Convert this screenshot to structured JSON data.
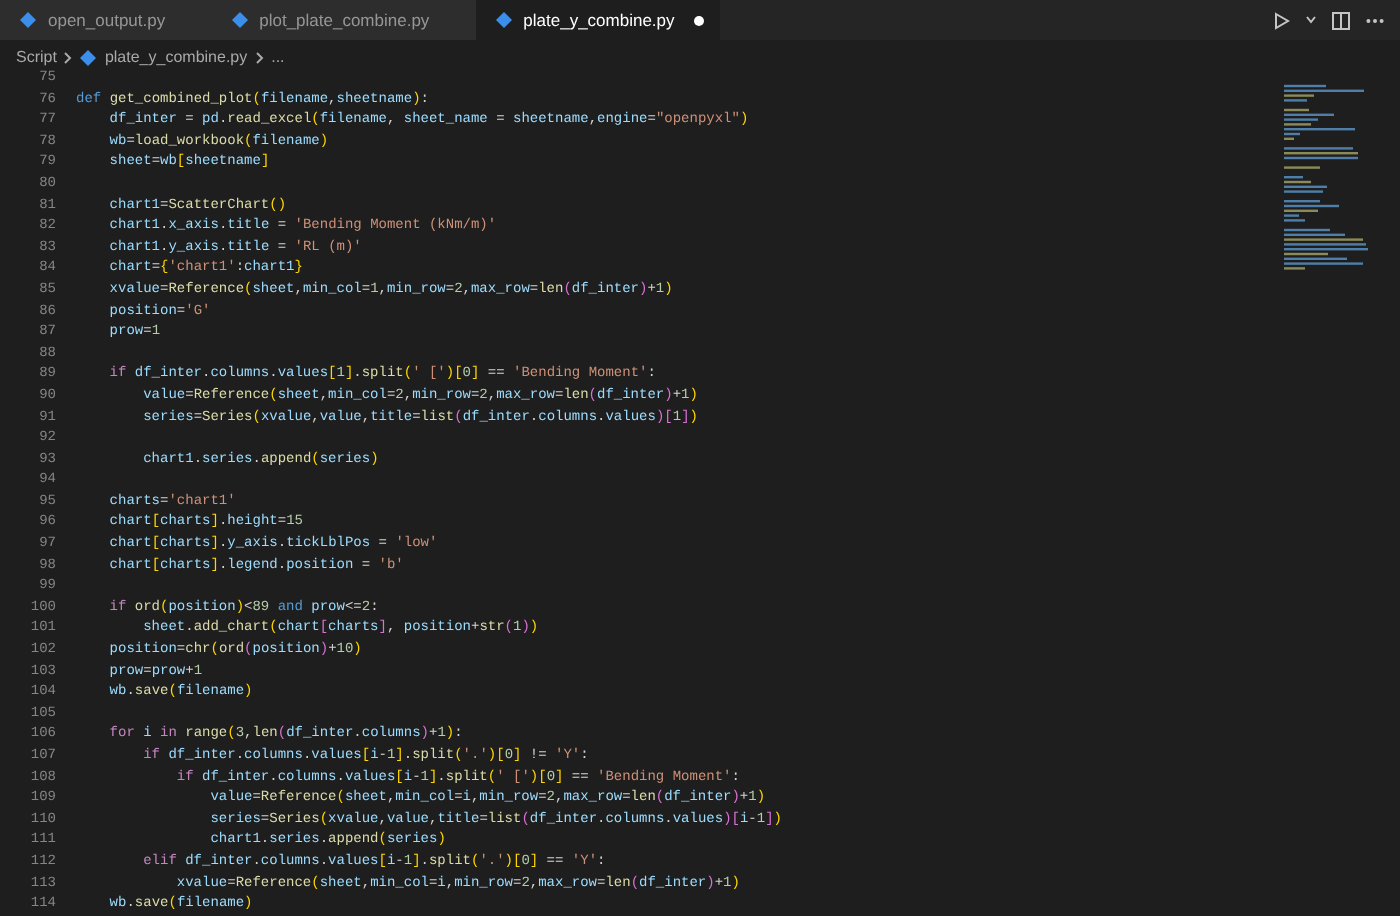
{
  "tabs": [
    {
      "label": "open_output.py",
      "selected": false,
      "modified": false
    },
    {
      "label": "plot_plate_combine.py",
      "selected": false,
      "modified": false
    },
    {
      "label": "plate_y_combine.py",
      "selected": true,
      "modified": true
    }
  ],
  "breadcrumbs": [
    {
      "label": "Script",
      "kind": "folder"
    },
    {
      "label": "plate_y_combine.py",
      "kind": "file"
    },
    {
      "label": "...",
      "kind": "more"
    }
  ],
  "code_lines": [
    {
      "number": "75"
    },
    {
      "number": "76",
      "tokens": [
        {
          "kind": "keyword",
          "text": "def "
        },
        {
          "kind": "function",
          "text": "get_combined_plot"
        },
        {
          "kind": "bracket1",
          "text": "("
        },
        {
          "kind": "name",
          "text": "filename"
        },
        {
          "kind": "plain",
          "text": ","
        },
        {
          "kind": "name",
          "text": "sheetname"
        },
        {
          "kind": "bracket1",
          "text": ")"
        },
        {
          "kind": "plain",
          "text": ":"
        }
      ]
    },
    {
      "number": "77",
      "tokens": [
        {
          "kind": "name",
          "text": "    df_inter"
        },
        {
          "kind": "plain",
          "text": " = "
        },
        {
          "kind": "name",
          "text": "pd"
        },
        {
          "kind": "plain",
          "text": "."
        },
        {
          "kind": "function",
          "text": "read_excel"
        },
        {
          "kind": "bracket1",
          "text": "("
        },
        {
          "kind": "name",
          "text": "filename"
        },
        {
          "kind": "plain",
          "text": ", "
        },
        {
          "kind": "name",
          "text": "sheet_name"
        },
        {
          "kind": "plain",
          "text": " = "
        },
        {
          "kind": "name",
          "text": "sheetname"
        },
        {
          "kind": "plain",
          "text": ","
        },
        {
          "kind": "name",
          "text": "engine"
        },
        {
          "kind": "plain",
          "text": "="
        },
        {
          "kind": "string",
          "text": "\"openpyxl\""
        },
        {
          "kind": "bracket1",
          "text": ")"
        }
      ]
    },
    {
      "number": "78",
      "tokens": [
        {
          "kind": "name",
          "text": "    wb"
        },
        {
          "kind": "plain",
          "text": "="
        },
        {
          "kind": "function",
          "text": "load_workbook"
        },
        {
          "kind": "bracket1",
          "text": "("
        },
        {
          "kind": "name",
          "text": "filename"
        },
        {
          "kind": "bracket1",
          "text": ")"
        }
      ]
    },
    {
      "number": "79",
      "tokens": [
        {
          "kind": "name",
          "text": "    sheet"
        },
        {
          "kind": "plain",
          "text": "="
        },
        {
          "kind": "name",
          "text": "wb"
        },
        {
          "kind": "bracket1",
          "text": "["
        },
        {
          "kind": "name",
          "text": "sheetname"
        },
        {
          "kind": "bracket1",
          "text": "]"
        }
      ]
    },
    {
      "number": "80"
    },
    {
      "number": "81",
      "tokens": [
        {
          "kind": "name",
          "text": "    chart1"
        },
        {
          "kind": "plain",
          "text": "="
        },
        {
          "kind": "function",
          "text": "ScatterChart"
        },
        {
          "kind": "bracket1",
          "text": "()"
        }
      ]
    },
    {
      "number": "82",
      "tokens": [
        {
          "kind": "name",
          "text": "    chart1"
        },
        {
          "kind": "plain",
          "text": "."
        },
        {
          "kind": "name",
          "text": "x_axis"
        },
        {
          "kind": "plain",
          "text": "."
        },
        {
          "kind": "name",
          "text": "title"
        },
        {
          "kind": "plain",
          "text": " = "
        },
        {
          "kind": "string",
          "text": "'Bending Moment (kNm/m)'"
        }
      ]
    },
    {
      "number": "83",
      "tokens": [
        {
          "kind": "name",
          "text": "    chart1"
        },
        {
          "kind": "plain",
          "text": "."
        },
        {
          "kind": "name",
          "text": "y_axis"
        },
        {
          "kind": "plain",
          "text": "."
        },
        {
          "kind": "name",
          "text": "title"
        },
        {
          "kind": "plain",
          "text": " = "
        },
        {
          "kind": "string",
          "text": "'RL (m)'"
        }
      ]
    },
    {
      "number": "84",
      "tokens": [
        {
          "kind": "name",
          "text": "    chart"
        },
        {
          "kind": "plain",
          "text": "="
        },
        {
          "kind": "bracket1",
          "text": "{"
        },
        {
          "kind": "string",
          "text": "'chart1'"
        },
        {
          "kind": "plain",
          "text": ":"
        },
        {
          "kind": "name",
          "text": "chart1"
        },
        {
          "kind": "bracket1",
          "text": "}"
        }
      ]
    },
    {
      "number": "85",
      "tokens": [
        {
          "kind": "name",
          "text": "    xvalue"
        },
        {
          "kind": "plain",
          "text": "="
        },
        {
          "kind": "function",
          "text": "Reference"
        },
        {
          "kind": "bracket1",
          "text": "("
        },
        {
          "kind": "name",
          "text": "sheet"
        },
        {
          "kind": "plain",
          "text": ","
        },
        {
          "kind": "name",
          "text": "min_col"
        },
        {
          "kind": "plain",
          "text": "="
        },
        {
          "kind": "number",
          "text": "1"
        },
        {
          "kind": "plain",
          "text": ","
        },
        {
          "kind": "name",
          "text": "min_row"
        },
        {
          "kind": "plain",
          "text": "="
        },
        {
          "kind": "number",
          "text": "2"
        },
        {
          "kind": "plain",
          "text": ","
        },
        {
          "kind": "name",
          "text": "max_row"
        },
        {
          "kind": "plain",
          "text": "="
        },
        {
          "kind": "function",
          "text": "len"
        },
        {
          "kind": "bracket2",
          "text": "("
        },
        {
          "kind": "name",
          "text": "df_inter"
        },
        {
          "kind": "bracket2",
          "text": ")"
        },
        {
          "kind": "plain",
          "text": "+"
        },
        {
          "kind": "number",
          "text": "1"
        },
        {
          "kind": "bracket1",
          "text": ")"
        }
      ]
    },
    {
      "number": "86",
      "tokens": [
        {
          "kind": "name",
          "text": "    position"
        },
        {
          "kind": "plain",
          "text": "="
        },
        {
          "kind": "string",
          "text": "'G'"
        }
      ]
    },
    {
      "number": "87",
      "tokens": [
        {
          "kind": "name",
          "text": "    prow"
        },
        {
          "kind": "plain",
          "text": "="
        },
        {
          "kind": "number",
          "text": "1"
        }
      ]
    },
    {
      "number": "88"
    },
    {
      "number": "89",
      "tokens": [
        {
          "kind": "control",
          "text": "    if "
        },
        {
          "kind": "name",
          "text": "df_inter"
        },
        {
          "kind": "plain",
          "text": "."
        },
        {
          "kind": "name",
          "text": "columns"
        },
        {
          "kind": "plain",
          "text": "."
        },
        {
          "kind": "name",
          "text": "values"
        },
        {
          "kind": "bracket1",
          "text": "["
        },
        {
          "kind": "number",
          "text": "1"
        },
        {
          "kind": "bracket1",
          "text": "]"
        },
        {
          "kind": "plain",
          "text": "."
        },
        {
          "kind": "function",
          "text": "split"
        },
        {
          "kind": "bracket1",
          "text": "("
        },
        {
          "kind": "string",
          "text": "' ['"
        },
        {
          "kind": "bracket1",
          "text": ")["
        },
        {
          "kind": "number",
          "text": "0"
        },
        {
          "kind": "bracket1",
          "text": "]"
        },
        {
          "kind": "plain",
          "text": " == "
        },
        {
          "kind": "string",
          "text": "'Bending Moment'"
        },
        {
          "kind": "plain",
          "text": ":"
        }
      ]
    },
    {
      "number": "90",
      "tokens": [
        {
          "kind": "name",
          "text": "        value"
        },
        {
          "kind": "plain",
          "text": "="
        },
        {
          "kind": "function",
          "text": "Reference"
        },
        {
          "kind": "bracket1",
          "text": "("
        },
        {
          "kind": "name",
          "text": "sheet"
        },
        {
          "kind": "plain",
          "text": ","
        },
        {
          "kind": "name",
          "text": "min_col"
        },
        {
          "kind": "plain",
          "text": "="
        },
        {
          "kind": "number",
          "text": "2"
        },
        {
          "kind": "plain",
          "text": ","
        },
        {
          "kind": "name",
          "text": "min_row"
        },
        {
          "kind": "plain",
          "text": "="
        },
        {
          "kind": "number",
          "text": "2"
        },
        {
          "kind": "plain",
          "text": ","
        },
        {
          "kind": "name",
          "text": "max_row"
        },
        {
          "kind": "plain",
          "text": "="
        },
        {
          "kind": "function",
          "text": "len"
        },
        {
          "kind": "bracket2",
          "text": "("
        },
        {
          "kind": "name",
          "text": "df_inter"
        },
        {
          "kind": "bracket2",
          "text": ")"
        },
        {
          "kind": "plain",
          "text": "+"
        },
        {
          "kind": "number",
          "text": "1"
        },
        {
          "kind": "bracket1",
          "text": ")"
        }
      ]
    },
    {
      "number": "91",
      "tokens": [
        {
          "kind": "name",
          "text": "        series"
        },
        {
          "kind": "plain",
          "text": "="
        },
        {
          "kind": "function",
          "text": "Series"
        },
        {
          "kind": "bracket1",
          "text": "("
        },
        {
          "kind": "name",
          "text": "xvalue"
        },
        {
          "kind": "plain",
          "text": ","
        },
        {
          "kind": "name",
          "text": "value"
        },
        {
          "kind": "plain",
          "text": ","
        },
        {
          "kind": "name",
          "text": "title"
        },
        {
          "kind": "plain",
          "text": "="
        },
        {
          "kind": "function",
          "text": "list"
        },
        {
          "kind": "bracket2",
          "text": "("
        },
        {
          "kind": "name",
          "text": "df_inter"
        },
        {
          "kind": "plain",
          "text": "."
        },
        {
          "kind": "name",
          "text": "columns"
        },
        {
          "kind": "plain",
          "text": "."
        },
        {
          "kind": "name",
          "text": "values"
        },
        {
          "kind": "bracket2",
          "text": ")["
        },
        {
          "kind": "number",
          "text": "1"
        },
        {
          "kind": "bracket2",
          "text": "]"
        },
        {
          "kind": "bracket1",
          "text": ")"
        }
      ]
    },
    {
      "number": "92"
    },
    {
      "number": "93",
      "tokens": [
        {
          "kind": "name",
          "text": "        chart1"
        },
        {
          "kind": "plain",
          "text": "."
        },
        {
          "kind": "name",
          "text": "series"
        },
        {
          "kind": "plain",
          "text": "."
        },
        {
          "kind": "function",
          "text": "append"
        },
        {
          "kind": "bracket1",
          "text": "("
        },
        {
          "kind": "name",
          "text": "series"
        },
        {
          "kind": "bracket1",
          "text": ")"
        }
      ]
    },
    {
      "number": "94"
    },
    {
      "number": "95",
      "tokens": [
        {
          "kind": "name",
          "text": "    charts"
        },
        {
          "kind": "plain",
          "text": "="
        },
        {
          "kind": "string",
          "text": "'chart1'"
        }
      ]
    },
    {
      "number": "96",
      "tokens": [
        {
          "kind": "name",
          "text": "    chart"
        },
        {
          "kind": "bracket1",
          "text": "["
        },
        {
          "kind": "name",
          "text": "charts"
        },
        {
          "kind": "bracket1",
          "text": "]"
        },
        {
          "kind": "plain",
          "text": "."
        },
        {
          "kind": "name",
          "text": "height"
        },
        {
          "kind": "plain",
          "text": "="
        },
        {
          "kind": "number",
          "text": "15"
        }
      ]
    },
    {
      "number": "97",
      "tokens": [
        {
          "kind": "name",
          "text": "    chart"
        },
        {
          "kind": "bracket1",
          "text": "["
        },
        {
          "kind": "name",
          "text": "charts"
        },
        {
          "kind": "bracket1",
          "text": "]"
        },
        {
          "kind": "plain",
          "text": "."
        },
        {
          "kind": "name",
          "text": "y_axis"
        },
        {
          "kind": "plain",
          "text": "."
        },
        {
          "kind": "name",
          "text": "tickLblPos"
        },
        {
          "kind": "plain",
          "text": " = "
        },
        {
          "kind": "string",
          "text": "'low'"
        }
      ]
    },
    {
      "number": "98",
      "tokens": [
        {
          "kind": "name",
          "text": "    chart"
        },
        {
          "kind": "bracket1",
          "text": "["
        },
        {
          "kind": "name",
          "text": "charts"
        },
        {
          "kind": "bracket1",
          "text": "]"
        },
        {
          "kind": "plain",
          "text": "."
        },
        {
          "kind": "name",
          "text": "legend"
        },
        {
          "kind": "plain",
          "text": "."
        },
        {
          "kind": "name",
          "text": "position"
        },
        {
          "kind": "plain",
          "text": " = "
        },
        {
          "kind": "string",
          "text": "'b'"
        }
      ]
    },
    {
      "number": "99"
    },
    {
      "number": "100",
      "tokens": [
        {
          "kind": "control",
          "text": "    if "
        },
        {
          "kind": "function",
          "text": "ord"
        },
        {
          "kind": "bracket1",
          "text": "("
        },
        {
          "kind": "name",
          "text": "position"
        },
        {
          "kind": "bracket1",
          "text": ")"
        },
        {
          "kind": "plain",
          "text": "<"
        },
        {
          "kind": "number",
          "text": "89"
        },
        {
          "kind": "keyword",
          "text": " and "
        },
        {
          "kind": "name",
          "text": "prow"
        },
        {
          "kind": "plain",
          "text": "<="
        },
        {
          "kind": "number",
          "text": "2"
        },
        {
          "kind": "plain",
          "text": ":"
        }
      ]
    },
    {
      "number": "101",
      "tokens": [
        {
          "kind": "name",
          "text": "        sheet"
        },
        {
          "kind": "plain",
          "text": "."
        },
        {
          "kind": "function",
          "text": "add_chart"
        },
        {
          "kind": "bracket1",
          "text": "("
        },
        {
          "kind": "name",
          "text": "chart"
        },
        {
          "kind": "bracket2",
          "text": "["
        },
        {
          "kind": "name",
          "text": "charts"
        },
        {
          "kind": "bracket2",
          "text": "]"
        },
        {
          "kind": "plain",
          "text": ", "
        },
        {
          "kind": "name",
          "text": "position"
        },
        {
          "kind": "plain",
          "text": "+"
        },
        {
          "kind": "function",
          "text": "str"
        },
        {
          "kind": "bracket2",
          "text": "("
        },
        {
          "kind": "number",
          "text": "1"
        },
        {
          "kind": "bracket2",
          "text": ")"
        },
        {
          "kind": "bracket1",
          "text": ")"
        }
      ]
    },
    {
      "number": "102",
      "tokens": [
        {
          "kind": "name",
          "text": "    position"
        },
        {
          "kind": "plain",
          "text": "="
        },
        {
          "kind": "function",
          "text": "chr"
        },
        {
          "kind": "bracket1",
          "text": "("
        },
        {
          "kind": "function",
          "text": "ord"
        },
        {
          "kind": "bracket2",
          "text": "("
        },
        {
          "kind": "name",
          "text": "position"
        },
        {
          "kind": "bracket2",
          "text": ")"
        },
        {
          "kind": "plain",
          "text": "+"
        },
        {
          "kind": "number",
          "text": "10"
        },
        {
          "kind": "bracket1",
          "text": ")"
        }
      ]
    },
    {
      "number": "103",
      "tokens": [
        {
          "kind": "name",
          "text": "    prow"
        },
        {
          "kind": "plain",
          "text": "="
        },
        {
          "kind": "name",
          "text": "prow"
        },
        {
          "kind": "plain",
          "text": "+"
        },
        {
          "kind": "number",
          "text": "1"
        }
      ]
    },
    {
      "number": "104",
      "tokens": [
        {
          "kind": "name",
          "text": "    wb"
        },
        {
          "kind": "plain",
          "text": "."
        },
        {
          "kind": "function",
          "text": "save"
        },
        {
          "kind": "bracket1",
          "text": "("
        },
        {
          "kind": "name",
          "text": "filename"
        },
        {
          "kind": "bracket1",
          "text": ")"
        }
      ]
    },
    {
      "number": "105"
    },
    {
      "number": "106",
      "tokens": [
        {
          "kind": "control",
          "text": "    for "
        },
        {
          "kind": "name",
          "text": "i"
        },
        {
          "kind": "control",
          "text": " in "
        },
        {
          "kind": "function",
          "text": "range"
        },
        {
          "kind": "bracket1",
          "text": "("
        },
        {
          "kind": "number",
          "text": "3"
        },
        {
          "kind": "plain",
          "text": ","
        },
        {
          "kind": "function",
          "text": "len"
        },
        {
          "kind": "bracket2",
          "text": "("
        },
        {
          "kind": "name",
          "text": "df_inter"
        },
        {
          "kind": "plain",
          "text": "."
        },
        {
          "kind": "name",
          "text": "columns"
        },
        {
          "kind": "bracket2",
          "text": ")"
        },
        {
          "kind": "plain",
          "text": "+"
        },
        {
          "kind": "number",
          "text": "1"
        },
        {
          "kind": "bracket1",
          "text": ")"
        },
        {
          "kind": "plain",
          "text": ":"
        }
      ]
    },
    {
      "number": "107",
      "tokens": [
        {
          "kind": "control",
          "text": "        if "
        },
        {
          "kind": "name",
          "text": "df_inter"
        },
        {
          "kind": "plain",
          "text": "."
        },
        {
          "kind": "name",
          "text": "columns"
        },
        {
          "kind": "plain",
          "text": "."
        },
        {
          "kind": "name",
          "text": "values"
        },
        {
          "kind": "bracket1",
          "text": "["
        },
        {
          "kind": "name",
          "text": "i"
        },
        {
          "kind": "plain",
          "text": "-"
        },
        {
          "kind": "number",
          "text": "1"
        },
        {
          "kind": "bracket1",
          "text": "]"
        },
        {
          "kind": "plain",
          "text": "."
        },
        {
          "kind": "function",
          "text": "split"
        },
        {
          "kind": "bracket1",
          "text": "("
        },
        {
          "kind": "string",
          "text": "'.'"
        },
        {
          "kind": "bracket1",
          "text": ")["
        },
        {
          "kind": "number",
          "text": "0"
        },
        {
          "kind": "bracket1",
          "text": "]"
        },
        {
          "kind": "plain",
          "text": " != "
        },
        {
          "kind": "string",
          "text": "'Y'"
        },
        {
          "kind": "plain",
          "text": ":"
        }
      ]
    },
    {
      "number": "108",
      "tokens": [
        {
          "kind": "control",
          "text": "            if "
        },
        {
          "kind": "name",
          "text": "df_inter"
        },
        {
          "kind": "plain",
          "text": "."
        },
        {
          "kind": "name",
          "text": "columns"
        },
        {
          "kind": "plain",
          "text": "."
        },
        {
          "kind": "name",
          "text": "values"
        },
        {
          "kind": "bracket1",
          "text": "["
        },
        {
          "kind": "name",
          "text": "i"
        },
        {
          "kind": "plain",
          "text": "-"
        },
        {
          "kind": "number",
          "text": "1"
        },
        {
          "kind": "bracket1",
          "text": "]"
        },
        {
          "kind": "plain",
          "text": "."
        },
        {
          "kind": "function",
          "text": "split"
        },
        {
          "kind": "bracket1",
          "text": "("
        },
        {
          "kind": "string",
          "text": "' ['"
        },
        {
          "kind": "bracket1",
          "text": ")["
        },
        {
          "kind": "number",
          "text": "0"
        },
        {
          "kind": "bracket1",
          "text": "]"
        },
        {
          "kind": "plain",
          "text": " == "
        },
        {
          "kind": "string",
          "text": "'Bending Moment'"
        },
        {
          "kind": "plain",
          "text": ":"
        }
      ]
    },
    {
      "number": "109",
      "tokens": [
        {
          "kind": "name",
          "text": "                value"
        },
        {
          "kind": "plain",
          "text": "="
        },
        {
          "kind": "function",
          "text": "Reference"
        },
        {
          "kind": "bracket1",
          "text": "("
        },
        {
          "kind": "name",
          "text": "sheet"
        },
        {
          "kind": "plain",
          "text": ","
        },
        {
          "kind": "name",
          "text": "min_col"
        },
        {
          "kind": "plain",
          "text": "="
        },
        {
          "kind": "name",
          "text": "i"
        },
        {
          "kind": "plain",
          "text": ","
        },
        {
          "kind": "name",
          "text": "min_row"
        },
        {
          "kind": "plain",
          "text": "="
        },
        {
          "kind": "number",
          "text": "2"
        },
        {
          "kind": "plain",
          "text": ","
        },
        {
          "kind": "name",
          "text": "max_row"
        },
        {
          "kind": "plain",
          "text": "="
        },
        {
          "kind": "function",
          "text": "len"
        },
        {
          "kind": "bracket2",
          "text": "("
        },
        {
          "kind": "name",
          "text": "df_inter"
        },
        {
          "kind": "bracket2",
          "text": ")"
        },
        {
          "kind": "plain",
          "text": "+"
        },
        {
          "kind": "number",
          "text": "1"
        },
        {
          "kind": "bracket1",
          "text": ")"
        }
      ]
    },
    {
      "number": "110",
      "tokens": [
        {
          "kind": "name",
          "text": "                series"
        },
        {
          "kind": "plain",
          "text": "="
        },
        {
          "kind": "function",
          "text": "Series"
        },
        {
          "kind": "bracket1",
          "text": "("
        },
        {
          "kind": "name",
          "text": "xvalue"
        },
        {
          "kind": "plain",
          "text": ","
        },
        {
          "kind": "name",
          "text": "value"
        },
        {
          "kind": "plain",
          "text": ","
        },
        {
          "kind": "name",
          "text": "title"
        },
        {
          "kind": "plain",
          "text": "="
        },
        {
          "kind": "function",
          "text": "list"
        },
        {
          "kind": "bracket2",
          "text": "("
        },
        {
          "kind": "name",
          "text": "df_inter"
        },
        {
          "kind": "plain",
          "text": "."
        },
        {
          "kind": "name",
          "text": "columns"
        },
        {
          "kind": "plain",
          "text": "."
        },
        {
          "kind": "name",
          "text": "values"
        },
        {
          "kind": "bracket2",
          "text": ")["
        },
        {
          "kind": "name",
          "text": "i"
        },
        {
          "kind": "plain",
          "text": "-"
        },
        {
          "kind": "number",
          "text": "1"
        },
        {
          "kind": "bracket2",
          "text": "]"
        },
        {
          "kind": "bracket1",
          "text": ")"
        }
      ]
    },
    {
      "number": "111",
      "tokens": [
        {
          "kind": "name",
          "text": "                chart1"
        },
        {
          "kind": "plain",
          "text": "."
        },
        {
          "kind": "name",
          "text": "series"
        },
        {
          "kind": "plain",
          "text": "."
        },
        {
          "kind": "function",
          "text": "append"
        },
        {
          "kind": "bracket1",
          "text": "("
        },
        {
          "kind": "name",
          "text": "series"
        },
        {
          "kind": "bracket1",
          "text": ")"
        }
      ]
    },
    {
      "number": "112",
      "tokens": [
        {
          "kind": "control",
          "text": "        elif "
        },
        {
          "kind": "name",
          "text": "df_inter"
        },
        {
          "kind": "plain",
          "text": "."
        },
        {
          "kind": "name",
          "text": "columns"
        },
        {
          "kind": "plain",
          "text": "."
        },
        {
          "kind": "name",
          "text": "values"
        },
        {
          "kind": "bracket1",
          "text": "["
        },
        {
          "kind": "name",
          "text": "i"
        },
        {
          "kind": "plain",
          "text": "-"
        },
        {
          "kind": "number",
          "text": "1"
        },
        {
          "kind": "bracket1",
          "text": "]"
        },
        {
          "kind": "plain",
          "text": "."
        },
        {
          "kind": "function",
          "text": "split"
        },
        {
          "kind": "bracket1",
          "text": "("
        },
        {
          "kind": "string",
          "text": "'.'"
        },
        {
          "kind": "bracket1",
          "text": ")["
        },
        {
          "kind": "number",
          "text": "0"
        },
        {
          "kind": "bracket1",
          "text": "]"
        },
        {
          "kind": "plain",
          "text": " == "
        },
        {
          "kind": "string",
          "text": "'Y'"
        },
        {
          "kind": "plain",
          "text": ":"
        }
      ]
    },
    {
      "number": "113",
      "tokens": [
        {
          "kind": "name",
          "text": "            xvalue"
        },
        {
          "kind": "plain",
          "text": "="
        },
        {
          "kind": "function",
          "text": "Reference"
        },
        {
          "kind": "bracket1",
          "text": "("
        },
        {
          "kind": "name",
          "text": "sheet"
        },
        {
          "kind": "plain",
          "text": ","
        },
        {
          "kind": "name",
          "text": "min_col"
        },
        {
          "kind": "plain",
          "text": "="
        },
        {
          "kind": "name",
          "text": "i"
        },
        {
          "kind": "plain",
          "text": ","
        },
        {
          "kind": "name",
          "text": "min_row"
        },
        {
          "kind": "plain",
          "text": "="
        },
        {
          "kind": "number",
          "text": "2"
        },
        {
          "kind": "plain",
          "text": ","
        },
        {
          "kind": "name",
          "text": "max_row"
        },
        {
          "kind": "plain",
          "text": "="
        },
        {
          "kind": "function",
          "text": "len"
        },
        {
          "kind": "bracket2",
          "text": "("
        },
        {
          "kind": "name",
          "text": "df_inter"
        },
        {
          "kind": "bracket2",
          "text": ")"
        },
        {
          "kind": "plain",
          "text": "+"
        },
        {
          "kind": "number",
          "text": "1"
        },
        {
          "kind": "bracket1",
          "text": ")"
        }
      ]
    },
    {
      "number": "114",
      "tokens": [
        {
          "kind": "name",
          "text": "    wb"
        },
        {
          "kind": "plain",
          "text": "."
        },
        {
          "kind": "function",
          "text": "save"
        },
        {
          "kind": "bracket1",
          "text": "("
        },
        {
          "kind": "name",
          "text": "filename"
        },
        {
          "kind": "bracket1",
          "text": ")"
        }
      ]
    }
  ]
}
